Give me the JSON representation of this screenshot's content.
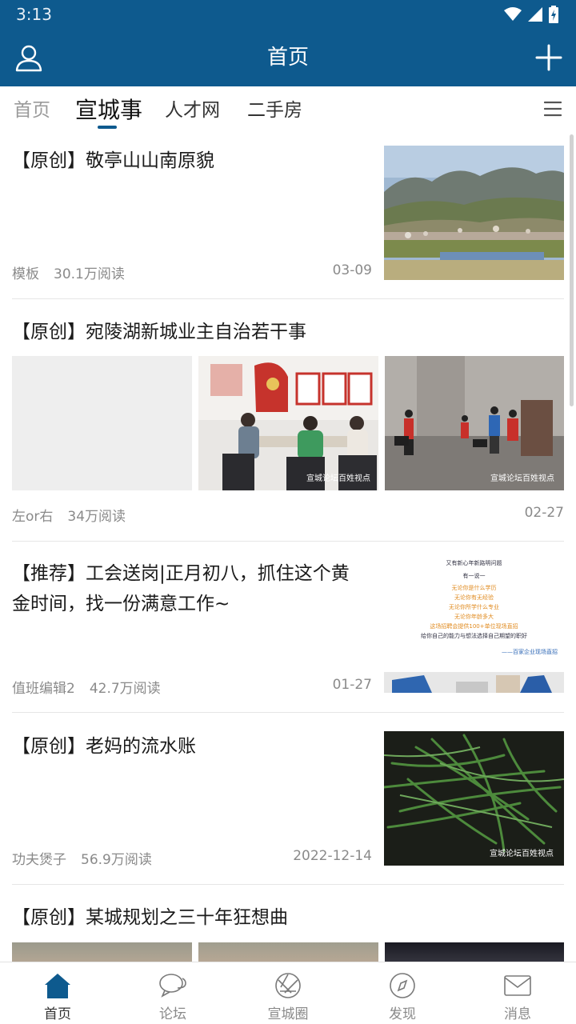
{
  "status_bar": {
    "time": "3:13"
  },
  "app_bar": {
    "title": "首页"
  },
  "tabs": [
    {
      "label": "首页"
    },
    {
      "label": "宣城事"
    },
    {
      "label": "人才网"
    },
    {
      "label": "二手房"
    }
  ],
  "articles": [
    {
      "title": "【原创】敬亭山山南原貌",
      "author": "模板",
      "reads": "30.1万阅读",
      "date": "03-09"
    },
    {
      "title": "【原创】宛陵湖新城业主自治若干事",
      "author": "左or右",
      "reads": "34万阅读",
      "date": "02-27"
    },
    {
      "title_line1": "【推荐】工会送岗|正月初八，抓住这个黄",
      "title_line2": "金时间，找一份满意工作~",
      "author": "值班编辑2",
      "reads": "42.7万阅读",
      "date": "01-27",
      "poster": {
        "line1": "又有新心年新路明问题",
        "line2": "有一说一",
        "line3": "无论你是什么学历",
        "line4": "无论你有无经验",
        "line5": "无论你所学什么专业",
        "line6": "无论你年龄多大",
        "line7": "这场招聘会提供100+单位现场直招",
        "line8": "给你自己的能力与想法选择自己期望的职好",
        "sign": "——百家企业现场直招"
      }
    },
    {
      "title": "【原创】老妈的流水账",
      "author": "功夫煲子",
      "reads": "56.9万阅读",
      "date": "2022-12-14"
    },
    {
      "title": "【原创】某城规划之三十年狂想曲"
    }
  ],
  "watermark": "宣城论坛百姓视点",
  "bottom_nav": [
    {
      "label": "首页",
      "icon": "home-icon"
    },
    {
      "label": "论坛",
      "icon": "forum-chat-icon"
    },
    {
      "label": "宣城圈",
      "icon": "aperture-circle-icon"
    },
    {
      "label": "发现",
      "icon": "compass-icon"
    },
    {
      "label": "消息",
      "icon": "mail-icon"
    }
  ],
  "colors": {
    "primary": "#0e5a8e",
    "text_dark": "#1a1a1a",
    "meta_gray": "#8a8a8a"
  }
}
